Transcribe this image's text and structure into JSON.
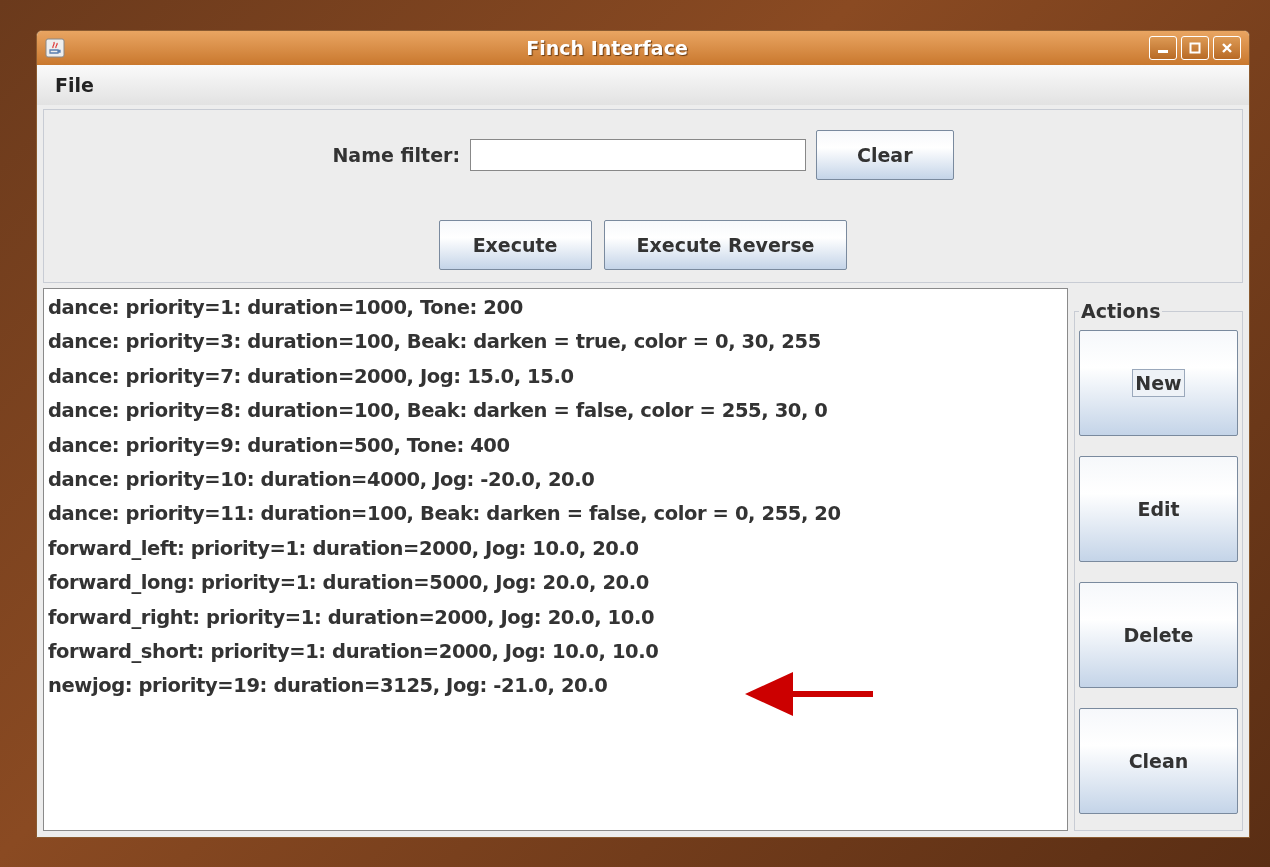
{
  "window": {
    "title": "Finch Interface"
  },
  "menu": [
    "File"
  ],
  "filter": {
    "label": "Name filter:",
    "clear_button": "Clear"
  },
  "execute_buttons": [
    "Execute",
    "Execute Reverse"
  ],
  "list_items": [
    "dance: priority=1: duration=1000, Tone: 200",
    "dance: priority=3: duration=100, Beak: darken = true, color = 0, 30, 255",
    "dance: priority=7: duration=2000, Jog: 15.0, 15.0",
    "dance: priority=8: duration=100, Beak: darken = false, color = 255, 30, 0",
    "dance: priority=9: duration=500, Tone: 400",
    "dance: priority=10: duration=4000, Jog: -20.0, 20.0",
    "dance: priority=11: duration=100, Beak: darken = false, color = 0, 255, 20",
    "forward_left: priority=1: duration=2000, Jog: 10.0, 20.0",
    "forward_long: priority=1: duration=5000, Jog: 20.0, 20.0",
    "forward_right: priority=1: duration=2000, Jog: 20.0, 10.0",
    "forward_short: priority=1: duration=2000, Jog: 10.0, 10.0",
    "newjog: priority=19: duration=3125, Jog: -21.0, 20.0"
  ],
  "actions": {
    "title": "Actions",
    "buttons": [
      {
        "label": "New",
        "focused": true
      },
      {
        "label": "Edit",
        "focused": false
      },
      {
        "label": "Delete",
        "focused": false
      },
      {
        "label": "Clean",
        "focused": false
      }
    ]
  }
}
